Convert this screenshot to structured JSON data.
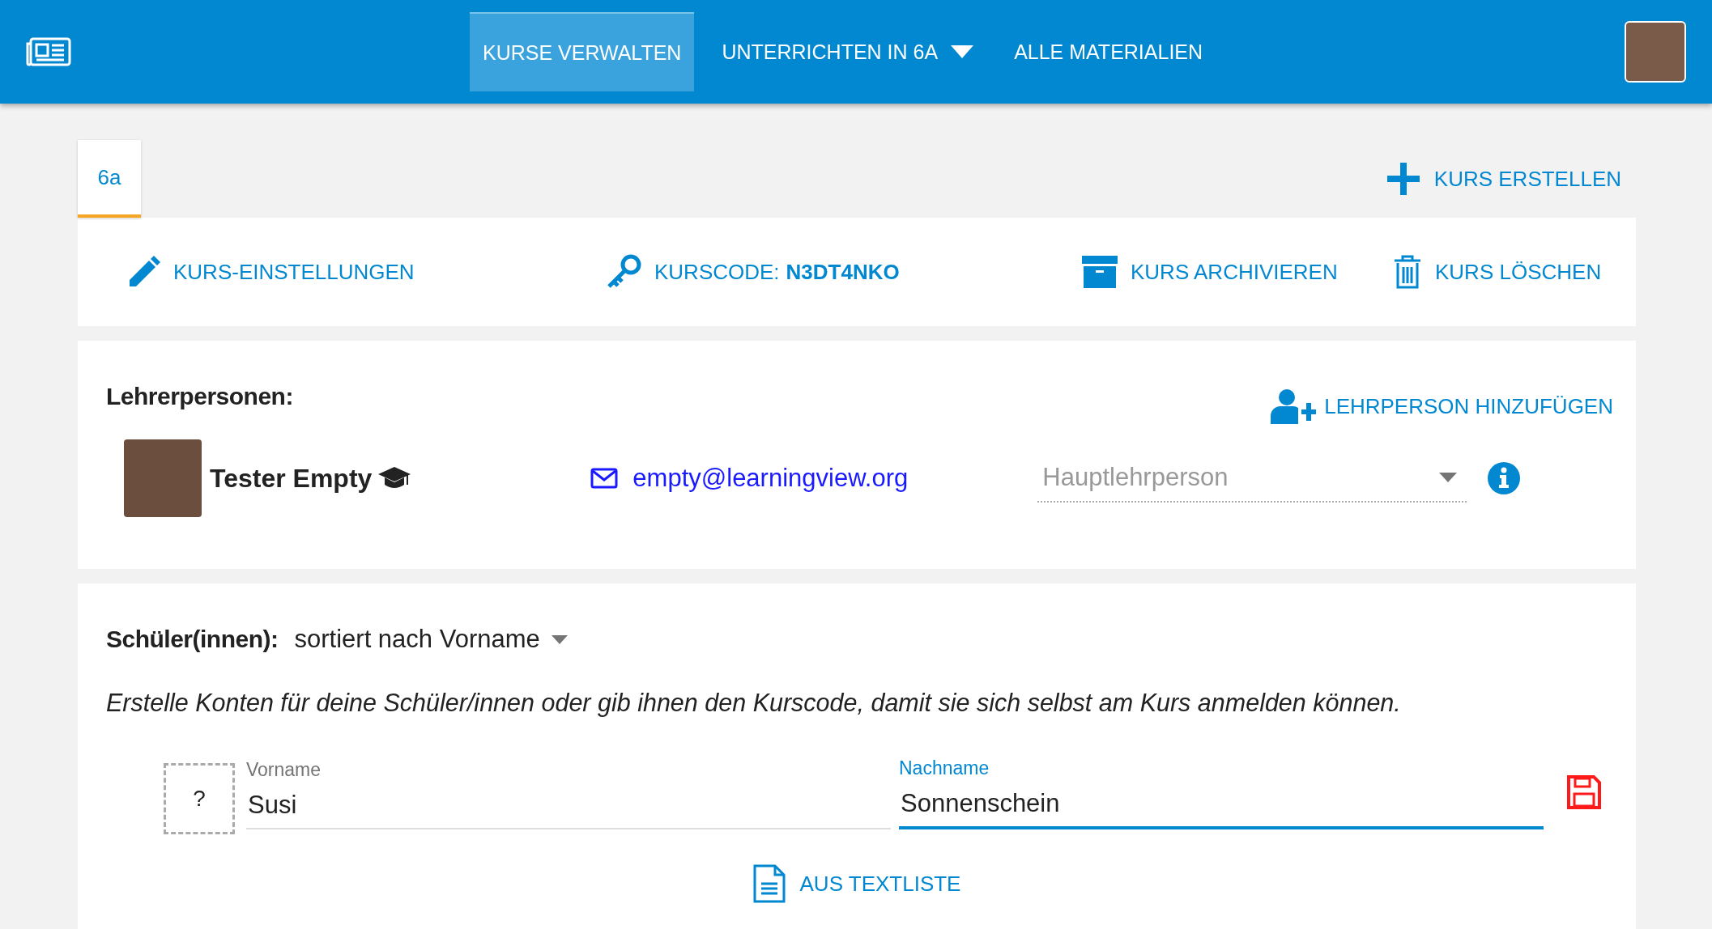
{
  "header": {
    "nav": [
      {
        "label": "KURSE VERWALTEN",
        "selected": true,
        "kind": "link"
      },
      {
        "label": "UNTERRICHTEN IN 6A",
        "selected": false,
        "kind": "dropdown"
      },
      {
        "label": "ALLE MATERIALIEN",
        "selected": false,
        "kind": "link"
      }
    ]
  },
  "course_tabs": [
    {
      "label": "6a",
      "selected": true
    }
  ],
  "create_course": "KURS ERSTELLEN",
  "course_actions": [
    {
      "kind": "settings",
      "label": "KURS-EINSTELLUNGEN"
    },
    {
      "kind": "code",
      "label": "KURSCODE:",
      "code": "N3DT4NKO"
    },
    {
      "kind": "archive",
      "label": "KURS ARCHIVIEREN"
    },
    {
      "kind": "delete",
      "label": "KURS LÖSCHEN"
    }
  ],
  "teachers": {
    "heading": "Lehrerpersonen:",
    "add": "LEHRPERSON HINZUFÜGEN",
    "rows": [
      {
        "name": "Tester Empty",
        "email": "empty@learningview.org",
        "role": "Hauptlehrperson"
      }
    ]
  },
  "students": {
    "heading": "Schüler(innen):",
    "sort": "sortiert nach Vorname",
    "hint": "Erstelle Konten für deine Schüler/innen oder gib ihnen den Kurscode, damit sie sich selbst am Kurs anmelden können.",
    "avatar_placeholder": "?",
    "fields": [
      {
        "label": "Vorname",
        "value": "Susi",
        "focused": false
      },
      {
        "label": "Nachname",
        "value": "Sonnenschein",
        "focused": true
      }
    ],
    "import": "AUS TEXTLISTE"
  }
}
